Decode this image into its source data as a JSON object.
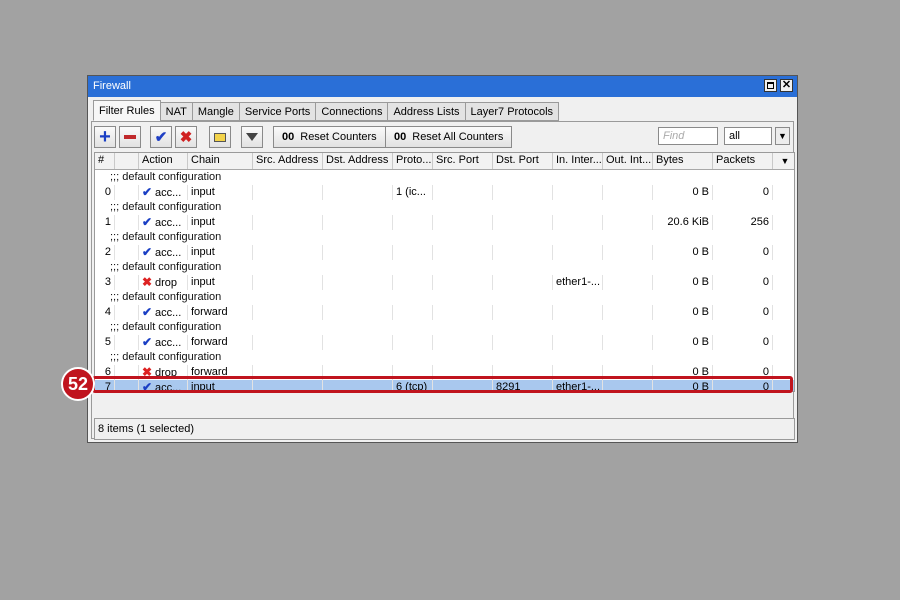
{
  "window": {
    "title": "Firewall"
  },
  "tabs": [
    {
      "label": "Filter Rules",
      "active": true
    },
    {
      "label": "NAT"
    },
    {
      "label": "Mangle"
    },
    {
      "label": "Service Ports"
    },
    {
      "label": "Connections"
    },
    {
      "label": "Address Lists"
    },
    {
      "label": "Layer7 Protocols"
    }
  ],
  "toolbar": {
    "add_icon": "plus-icon",
    "remove_icon": "minus-icon",
    "enable_icon": "check-icon",
    "disable_icon": "x-icon",
    "comment_icon": "note-icon",
    "filter_icon": "filter-icon",
    "reset_counters_glyph": "00",
    "reset_counters_label": "Reset Counters",
    "reset_all_counters_glyph": "00",
    "reset_all_counters_label": "Reset All Counters",
    "find_placeholder": "Find",
    "scope_value": "all"
  },
  "columns": [
    "#",
    "",
    "Action",
    "Chain",
    "Src. Address",
    "Dst. Address",
    "Proto...",
    "Src. Port",
    "Dst. Port",
    "In. Inter...",
    "Out. Int...",
    "Bytes",
    "Packets"
  ],
  "comment_text": ";;; default configuration",
  "rules": [
    {
      "num": "0",
      "action": "acc...",
      "action_type": "accept",
      "chain": "input",
      "src": "",
      "dst": "",
      "proto": "1 (ic...",
      "sport": "",
      "dport": "",
      "in": "",
      "out": "",
      "bytes": "0 B",
      "packets": "0"
    },
    {
      "num": "1",
      "action": "acc...",
      "action_type": "accept",
      "chain": "input",
      "src": "",
      "dst": "",
      "proto": "",
      "sport": "",
      "dport": "",
      "in": "",
      "out": "",
      "bytes": "20.6 KiB",
      "packets": "256"
    },
    {
      "num": "2",
      "action": "acc...",
      "action_type": "accept",
      "chain": "input",
      "src": "",
      "dst": "",
      "proto": "",
      "sport": "",
      "dport": "",
      "in": "",
      "out": "",
      "bytes": "0 B",
      "packets": "0"
    },
    {
      "num": "3",
      "action": "drop",
      "action_type": "drop",
      "chain": "input",
      "src": "",
      "dst": "",
      "proto": "",
      "sport": "",
      "dport": "",
      "in": "ether1-...",
      "out": "",
      "bytes": "0 B",
      "packets": "0"
    },
    {
      "num": "4",
      "action": "acc...",
      "action_type": "accept",
      "chain": "forward",
      "src": "",
      "dst": "",
      "proto": "",
      "sport": "",
      "dport": "",
      "in": "",
      "out": "",
      "bytes": "0 B",
      "packets": "0"
    },
    {
      "num": "5",
      "action": "acc...",
      "action_type": "accept",
      "chain": "forward",
      "src": "",
      "dst": "",
      "proto": "",
      "sport": "",
      "dport": "",
      "in": "",
      "out": "",
      "bytes": "0 B",
      "packets": "0"
    },
    {
      "num": "6",
      "action": "drop",
      "action_type": "drop",
      "chain": "forward",
      "src": "",
      "dst": "",
      "proto": "",
      "sport": "",
      "dport": "",
      "in": "",
      "out": "",
      "bytes": "0 B",
      "packets": "0"
    },
    {
      "num": "7",
      "action": "acc...",
      "action_type": "accept",
      "chain": "input",
      "src": "",
      "dst": "",
      "proto": "6 (tcp)",
      "sport": "",
      "dport": "8291",
      "in": "ether1-...",
      "out": "",
      "bytes": "0 B",
      "packets": "0",
      "selected": true,
      "no_comment": true
    }
  ],
  "status": {
    "text": "8 items (1 selected)"
  },
  "annotation": {
    "step_number": "52",
    "highlight_color": "#c0141e"
  }
}
